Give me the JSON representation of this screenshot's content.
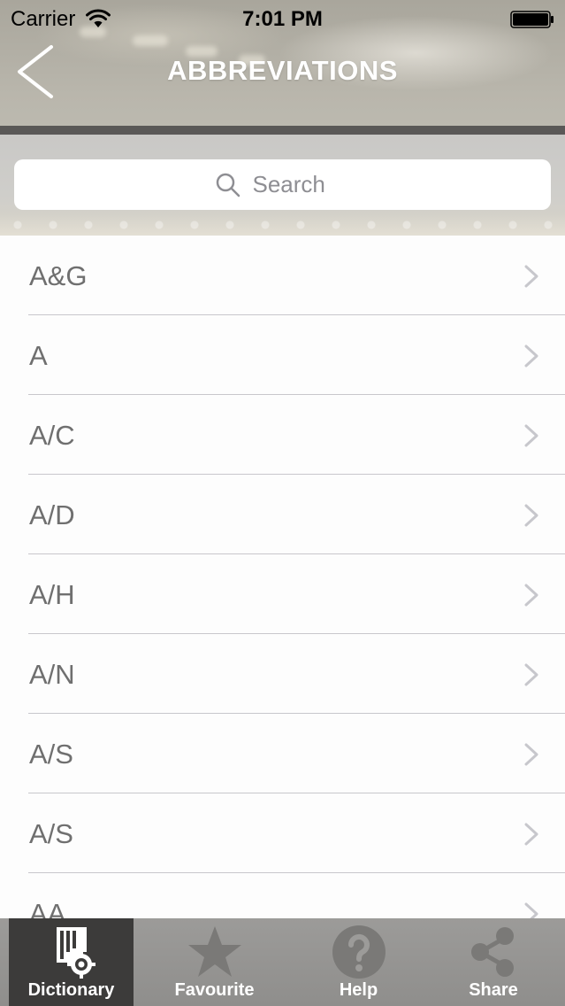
{
  "status_bar": {
    "carrier": "Carrier",
    "time": "7:01 PM"
  },
  "nav": {
    "title": "ABBREVIATIONS"
  },
  "search": {
    "placeholder": "Search"
  },
  "list": {
    "items": [
      {
        "label": "A&G"
      },
      {
        "label": "A"
      },
      {
        "label": "A/C"
      },
      {
        "label": "A/D"
      },
      {
        "label": "A/H"
      },
      {
        "label": "A/N"
      },
      {
        "label": "A/S"
      },
      {
        "label": "A/S"
      },
      {
        "label": "AA"
      }
    ]
  },
  "tab_bar": {
    "tabs": [
      {
        "label": "Dictionary",
        "icon": "dictionary-icon",
        "active": true
      },
      {
        "label": "Favourite",
        "icon": "star-icon",
        "active": false
      },
      {
        "label": "Help",
        "icon": "help-icon",
        "active": false
      },
      {
        "label": "Share",
        "icon": "share-icon",
        "active": false
      }
    ]
  },
  "colors": {
    "tab_active_bg": "#3c3b3a",
    "tab_bar_bg": "#9c9b99",
    "list_text": "#6f6f6f",
    "separator": "#c8c7cc"
  }
}
